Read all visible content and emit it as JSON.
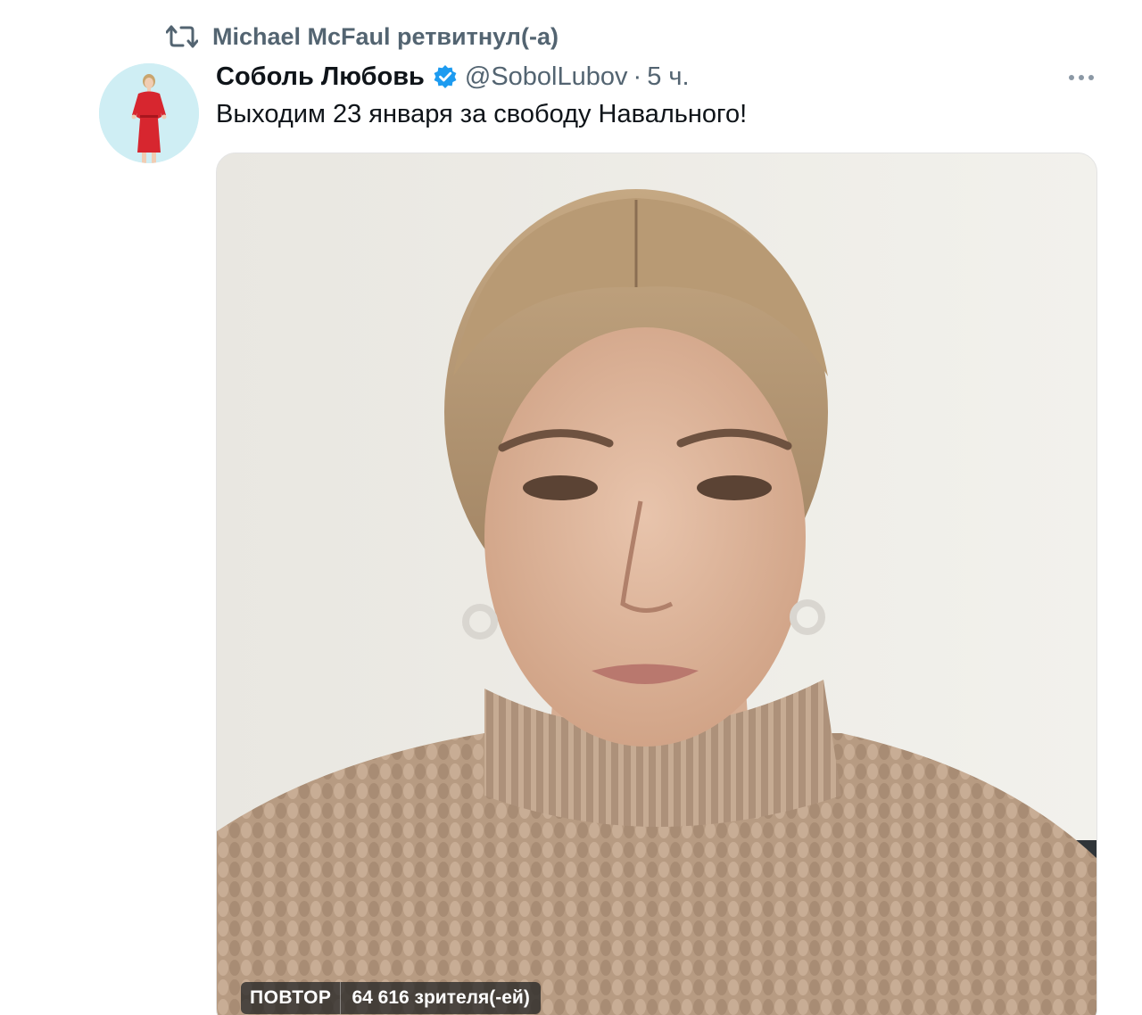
{
  "retweet": {
    "label": "Michael McFaul ретвитнул(-а)",
    "icon": "retweet-icon"
  },
  "tweet": {
    "author_name": "Соболь Любовь",
    "handle": "@SobolLubov",
    "separator": "·",
    "time": "5 ч.",
    "text": "Выходим 23 января за свободу Навального!",
    "verified_icon": "verified-badge-icon",
    "more_icon": "more-options-icon"
  },
  "video": {
    "replay_label": "ПОВТОР",
    "viewers_label": "64 616 зрителя(-ей)"
  },
  "colors": {
    "secondary_text": "#536471",
    "primary_text": "#0f1419",
    "verified": "#1d9bf0",
    "avatar_bg": "#cfeef4",
    "avatar_dress": "#d7262f"
  }
}
